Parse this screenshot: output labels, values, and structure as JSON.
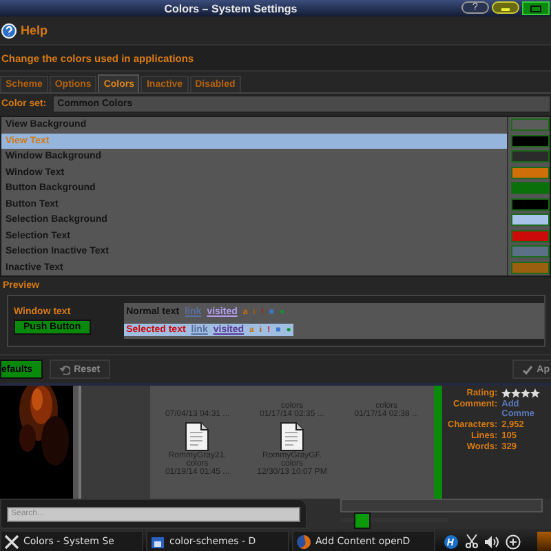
{
  "window": {
    "title": "Colors – System Settings",
    "help_button": "?"
  },
  "help": {
    "label": "Help"
  },
  "description": "Change the colors used in applications",
  "tabs": [
    {
      "label": "Scheme",
      "selected": false
    },
    {
      "label": "Options",
      "selected": false
    },
    {
      "label": "Colors",
      "selected": true
    },
    {
      "label": "Inactive",
      "selected": false
    },
    {
      "label": "Disabled",
      "selected": false
    }
  ],
  "color_set": {
    "label": "Color set:",
    "value": "Common Colors"
  },
  "color_roles": [
    {
      "name": "View Background",
      "selected": false,
      "color": "#5c5c5c"
    },
    {
      "name": "View Text",
      "selected": true,
      "color": "#000000"
    },
    {
      "name": "Window Background",
      "selected": false,
      "color": "#2b2b2b"
    },
    {
      "name": "Window Text",
      "selected": false,
      "color": "#d06e0a"
    },
    {
      "name": "Button Background",
      "selected": false,
      "color": "#0a700a"
    },
    {
      "name": "Button Text",
      "selected": false,
      "color": "#000000"
    },
    {
      "name": "Selection Background",
      "selected": false,
      "color": "#a8c4e8"
    },
    {
      "name": "Selection Text",
      "selected": false,
      "color": "#cc0a0a"
    },
    {
      "name": "Selection Inactive Text",
      "selected": false,
      "color": "#5c7088"
    },
    {
      "name": "Inactive Text",
      "selected": false,
      "color": "#9a6010"
    }
  ],
  "preview": {
    "title": "Preview",
    "window_text": "Window text",
    "push_button": "Push Button",
    "lines": [
      {
        "kind": "normal",
        "label": "Normal text",
        "link": "link",
        "visited": "visited",
        "marks": [
          {
            "text": "a",
            "color": "#d06e0a"
          },
          {
            "text": "i",
            "color": "#9a6010"
          },
          {
            "text": "!",
            "color": "#cc0a0a"
          },
          {
            "text": "■",
            "color": "#3a78c8"
          },
          {
            "text": "●",
            "color": "#0a9a2a"
          }
        ]
      },
      {
        "kind": "selected",
        "label": "Selected text",
        "link": "link",
        "visited": "visited",
        "marks": [
          {
            "text": "a",
            "color": "#d06e0a"
          },
          {
            "text": "i",
            "color": "#9a6010"
          },
          {
            "text": "!",
            "color": "#cc0a0a"
          },
          {
            "text": "■",
            "color": "#3a78c8"
          },
          {
            "text": "●",
            "color": "#0a9a2a"
          }
        ]
      }
    ]
  },
  "buttons": [
    {
      "label": "efaults",
      "kind": "primary",
      "disabled": false
    },
    {
      "label": "Reset",
      "kind": "reset",
      "disabled": true
    },
    {
      "label": "Ap",
      "kind": "apply",
      "disabled": true
    }
  ],
  "files": [
    {
      "kind": "cut",
      "lines": [
        "07/04/13 04:31 ..."
      ]
    },
    {
      "kind": "cut",
      "lines": [
        "colors",
        "01/17/14 02:35 ..."
      ]
    },
    {
      "kind": "cut",
      "lines": [
        "colors",
        "01/17/14 02:38 ..."
      ]
    },
    {
      "kind": "file",
      "lines": [
        "RommyGray21.",
        "colors",
        "01/19/14 01:45 ..."
      ]
    },
    {
      "kind": "file",
      "lines": [
        "RommyGrayGF.",
        "colors",
        "12/30/13 10:07 PM"
      ]
    }
  ],
  "details": [
    {
      "kind": "stars",
      "label": "Rating:",
      "stars": 4
    },
    {
      "kind": "link",
      "label": "Comment:",
      "value": "Add Comme"
    },
    {
      "kind": "text",
      "label": "Characters:",
      "value": "2,952"
    },
    {
      "kind": "text",
      "label": "Lines:",
      "value": "105"
    },
    {
      "kind": "text",
      "label": "Words:",
      "value": "329"
    }
  ],
  "search": {
    "placeholder": "Search..."
  },
  "zoom_slider": {
    "level": 0.2
  },
  "taskbar": {
    "tasks": [
      {
        "kind": "settings",
        "label": "Colors - System Se"
      },
      {
        "kind": "files",
        "label": "color-schemes - D"
      },
      {
        "kind": "browser",
        "label": "Add Content openD"
      }
    ]
  }
}
